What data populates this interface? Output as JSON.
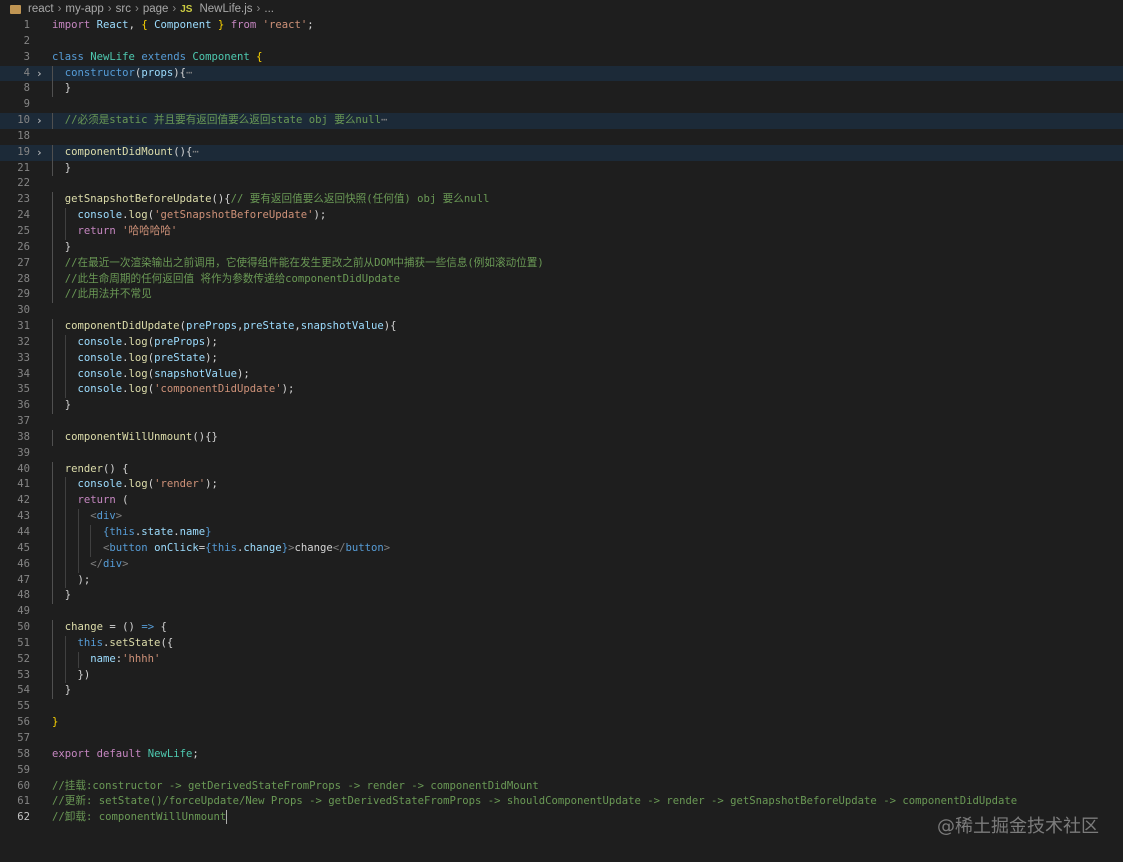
{
  "breadcrumb": {
    "items": [
      "react",
      "my-app",
      "src",
      "page"
    ],
    "file_badge": "JS",
    "file": "NewLife.js",
    "more": "..."
  },
  "watermark": "@稀土掘金技术社区",
  "editor": {
    "active_line": 62,
    "lines": [
      {
        "n": 1,
        "indent": 0,
        "tokens": [
          [
            "k",
            "import"
          ],
          [
            "p",
            " "
          ],
          [
            "v",
            "React"
          ],
          [
            "p",
            ", "
          ],
          [
            "b",
            "{"
          ],
          [
            "p",
            " "
          ],
          [
            "v",
            "Component"
          ],
          [
            "p",
            " "
          ],
          [
            "b",
            "}"
          ],
          [
            "p",
            " "
          ],
          [
            "k",
            "from"
          ],
          [
            "p",
            " "
          ],
          [
            "str",
            "'react'"
          ],
          [
            "p",
            ";"
          ]
        ]
      },
      {
        "n": 2,
        "indent": 0,
        "tokens": []
      },
      {
        "n": 3,
        "indent": 0,
        "tokens": [
          [
            "s",
            "class"
          ],
          [
            "p",
            " "
          ],
          [
            "t",
            "NewLife"
          ],
          [
            "p",
            " "
          ],
          [
            "s",
            "extends"
          ],
          [
            "p",
            " "
          ],
          [
            "t",
            "Component"
          ],
          [
            "p",
            " "
          ],
          [
            "b",
            "{"
          ]
        ]
      },
      {
        "n": 4,
        "indent": 1,
        "fold": true,
        "hl": true,
        "tokens": [
          [
            "s",
            "constructor"
          ],
          [
            "p",
            "("
          ],
          [
            "v",
            "props"
          ],
          [
            "p",
            "){"
          ],
          [
            "e",
            "⋯"
          ]
        ]
      },
      {
        "n": 8,
        "indent": 1,
        "tokens": [
          [
            "p",
            "}"
          ]
        ]
      },
      {
        "n": 9,
        "indent": 0,
        "tokens": []
      },
      {
        "n": 10,
        "indent": 1,
        "fold": true,
        "hl": true,
        "tokens": [
          [
            "c",
            "//必须是static 并且要有返回值要么返回state obj 要么null"
          ],
          [
            "e",
            "⋯"
          ]
        ]
      },
      {
        "n": 18,
        "indent": 0,
        "tokens": []
      },
      {
        "n": 19,
        "indent": 1,
        "fold": true,
        "hl": true,
        "tokens": [
          [
            "f",
            "componentDidMount"
          ],
          [
            "p",
            "(){"
          ],
          [
            "e",
            "⋯"
          ]
        ]
      },
      {
        "n": 21,
        "indent": 1,
        "tokens": [
          [
            "p",
            "}"
          ]
        ]
      },
      {
        "n": 22,
        "indent": 0,
        "tokens": []
      },
      {
        "n": 23,
        "indent": 1,
        "tokens": [
          [
            "f",
            "getSnapshotBeforeUpdate"
          ],
          [
            "p",
            "(){"
          ],
          [
            "c",
            "// 要有返回值要么返回快照(任何值) obj 要么null"
          ]
        ]
      },
      {
        "n": 24,
        "indent": 2,
        "tokens": [
          [
            "v",
            "console"
          ],
          [
            "p",
            "."
          ],
          [
            "f",
            "log"
          ],
          [
            "p",
            "("
          ],
          [
            "str",
            "'getSnapshotBeforeUpdate'"
          ],
          [
            "p",
            ");"
          ]
        ]
      },
      {
        "n": 25,
        "indent": 2,
        "tokens": [
          [
            "k",
            "return"
          ],
          [
            "p",
            " "
          ],
          [
            "str",
            "'哈哈哈哈'"
          ]
        ]
      },
      {
        "n": 26,
        "indent": 1,
        "tokens": [
          [
            "p",
            "}"
          ]
        ]
      },
      {
        "n": 27,
        "indent": 1,
        "tokens": [
          [
            "c",
            "//在最近一次渲染输出之前调用，它使得组件能在发生更改之前从DOM中捕获一些信息(例如滚动位置)"
          ]
        ]
      },
      {
        "n": 28,
        "indent": 1,
        "tokens": [
          [
            "c",
            "//此生命周期的任何返回值 将作为参数传递给componentDidUpdate"
          ]
        ]
      },
      {
        "n": 29,
        "indent": 1,
        "tokens": [
          [
            "c",
            "//此用法并不常见"
          ]
        ]
      },
      {
        "n": 30,
        "indent": 0,
        "tokens": []
      },
      {
        "n": 31,
        "indent": 1,
        "tokens": [
          [
            "f",
            "componentDidUpdate"
          ],
          [
            "p",
            "("
          ],
          [
            "v",
            "preProps"
          ],
          [
            "p",
            ","
          ],
          [
            "v",
            "preState"
          ],
          [
            "p",
            ","
          ],
          [
            "v",
            "snapshotValue"
          ],
          [
            "p",
            "){"
          ]
        ]
      },
      {
        "n": 32,
        "indent": 2,
        "tokens": [
          [
            "v",
            "console"
          ],
          [
            "p",
            "."
          ],
          [
            "f",
            "log"
          ],
          [
            "p",
            "("
          ],
          [
            "v",
            "preProps"
          ],
          [
            "p",
            ");"
          ]
        ]
      },
      {
        "n": 33,
        "indent": 2,
        "tokens": [
          [
            "v",
            "console"
          ],
          [
            "p",
            "."
          ],
          [
            "f",
            "log"
          ],
          [
            "p",
            "("
          ],
          [
            "v",
            "preState"
          ],
          [
            "p",
            ");"
          ]
        ]
      },
      {
        "n": 34,
        "indent": 2,
        "tokens": [
          [
            "v",
            "console"
          ],
          [
            "p",
            "."
          ],
          [
            "f",
            "log"
          ],
          [
            "p",
            "("
          ],
          [
            "v",
            "snapshotValue"
          ],
          [
            "p",
            ");"
          ]
        ]
      },
      {
        "n": 35,
        "indent": 2,
        "tokens": [
          [
            "v",
            "console"
          ],
          [
            "p",
            "."
          ],
          [
            "f",
            "log"
          ],
          [
            "p",
            "("
          ],
          [
            "str",
            "'componentDidUpdate'"
          ],
          [
            "p",
            ");"
          ]
        ]
      },
      {
        "n": 36,
        "indent": 1,
        "tokens": [
          [
            "p",
            "}"
          ]
        ]
      },
      {
        "n": 37,
        "indent": 0,
        "tokens": []
      },
      {
        "n": 38,
        "indent": 1,
        "tokens": [
          [
            "f",
            "componentWillUnmount"
          ],
          [
            "p",
            "(){}"
          ]
        ]
      },
      {
        "n": 39,
        "indent": 0,
        "tokens": []
      },
      {
        "n": 40,
        "indent": 1,
        "tokens": [
          [
            "f",
            "render"
          ],
          [
            "p",
            "() {"
          ]
        ]
      },
      {
        "n": 41,
        "indent": 2,
        "tokens": [
          [
            "v",
            "console"
          ],
          [
            "p",
            "."
          ],
          [
            "f",
            "log"
          ],
          [
            "p",
            "("
          ],
          [
            "str",
            "'render'"
          ],
          [
            "p",
            ");"
          ]
        ]
      },
      {
        "n": 42,
        "indent": 2,
        "tokens": [
          [
            "k",
            "return"
          ],
          [
            "p",
            " ("
          ]
        ]
      },
      {
        "n": 43,
        "indent": 3,
        "tokens": [
          [
            "tp",
            "<"
          ],
          [
            "tg",
            "div"
          ],
          [
            "tp",
            ">"
          ]
        ]
      },
      {
        "n": 44,
        "indent": 4,
        "tokens": [
          [
            "s",
            "{"
          ],
          [
            "s",
            "this"
          ],
          [
            "p",
            "."
          ],
          [
            "v",
            "state"
          ],
          [
            "p",
            "."
          ],
          [
            "v",
            "name"
          ],
          [
            "s",
            "}"
          ]
        ]
      },
      {
        "n": 45,
        "indent": 4,
        "tokens": [
          [
            "tp",
            "<"
          ],
          [
            "tg",
            "button"
          ],
          [
            "p",
            " "
          ],
          [
            "v",
            "onClick"
          ],
          [
            "p",
            "="
          ],
          [
            "s",
            "{"
          ],
          [
            "s",
            "this"
          ],
          [
            "p",
            "."
          ],
          [
            "v",
            "change"
          ],
          [
            "s",
            "}"
          ],
          [
            "tp",
            ">"
          ],
          [
            "p",
            "change"
          ],
          [
            "tp",
            "</"
          ],
          [
            "tg",
            "button"
          ],
          [
            "tp",
            ">"
          ]
        ]
      },
      {
        "n": 46,
        "indent": 3,
        "tokens": [
          [
            "tp",
            "</"
          ],
          [
            "tg",
            "div"
          ],
          [
            "tp",
            ">"
          ]
        ]
      },
      {
        "n": 47,
        "indent": 2,
        "tokens": [
          [
            "p",
            ");"
          ]
        ]
      },
      {
        "n": 48,
        "indent": 1,
        "tokens": [
          [
            "p",
            "}"
          ]
        ]
      },
      {
        "n": 49,
        "indent": 0,
        "tokens": []
      },
      {
        "n": 50,
        "indent": 1,
        "tokens": [
          [
            "f",
            "change"
          ],
          [
            "p",
            " = () "
          ],
          [
            "s",
            "=>"
          ],
          [
            "p",
            " {"
          ]
        ]
      },
      {
        "n": 51,
        "indent": 2,
        "tokens": [
          [
            "s",
            "this"
          ],
          [
            "p",
            "."
          ],
          [
            "f",
            "setState"
          ],
          [
            "p",
            "({"
          ]
        ]
      },
      {
        "n": 52,
        "indent": 3,
        "tokens": [
          [
            "v",
            "name"
          ],
          [
            "p",
            ":"
          ],
          [
            "str",
            "'hhhh'"
          ]
        ]
      },
      {
        "n": 53,
        "indent": 2,
        "tokens": [
          [
            "p",
            "})"
          ]
        ]
      },
      {
        "n": 54,
        "indent": 1,
        "tokens": [
          [
            "p",
            "}"
          ]
        ]
      },
      {
        "n": 55,
        "indent": 0,
        "tokens": []
      },
      {
        "n": 56,
        "indent": 0,
        "tokens": [
          [
            "b",
            "}"
          ]
        ]
      },
      {
        "n": 57,
        "indent": 0,
        "tokens": []
      },
      {
        "n": 58,
        "indent": 0,
        "tokens": [
          [
            "k",
            "export"
          ],
          [
            "p",
            " "
          ],
          [
            "k",
            "default"
          ],
          [
            "p",
            " "
          ],
          [
            "t",
            "NewLife"
          ],
          [
            "p",
            ";"
          ]
        ]
      },
      {
        "n": 59,
        "indent": 0,
        "tokens": []
      },
      {
        "n": 60,
        "indent": 0,
        "tokens": [
          [
            "c",
            "//挂载:constructor -> getDerivedStateFromProps -> render -> componentDidMount"
          ]
        ]
      },
      {
        "n": 61,
        "indent": 0,
        "tokens": [
          [
            "c",
            "//更新: setState()/forceUpdate/New Props -> getDerivedStateFromProps -> shouldComponentUpdate -> render -> getSnapshotBeforeUpdate -> componentDidUpdate"
          ]
        ]
      },
      {
        "n": 62,
        "indent": 0,
        "cursor": true,
        "tokens": [
          [
            "c",
            "//卸载: componentWillUnmount"
          ]
        ]
      }
    ]
  }
}
